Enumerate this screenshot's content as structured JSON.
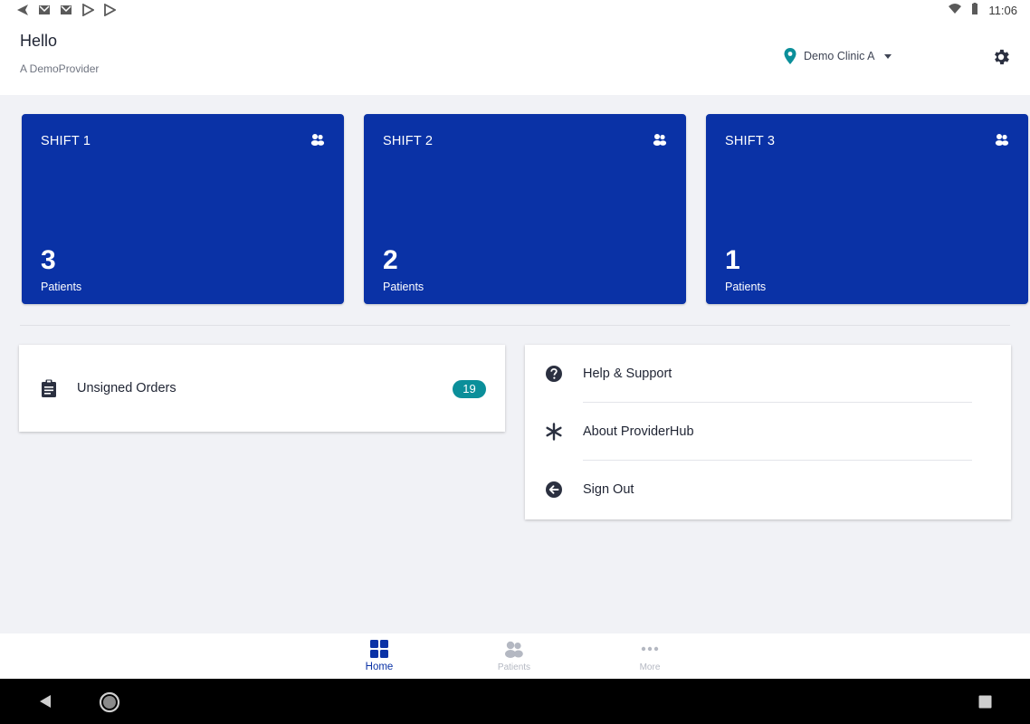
{
  "status_bar": {
    "time": "11:06",
    "icons": [
      "back-arrow-icon",
      "gmail-icon",
      "gmail-icon",
      "play-store-icon",
      "play-store-icon",
      "wifi-icon",
      "battery-icon"
    ]
  },
  "header": {
    "greeting": "Hello",
    "provider_name": "A DemoProvider",
    "clinic_name": "Demo Clinic A"
  },
  "shifts": [
    {
      "title": "SHIFT 1",
      "count": "3",
      "label": "Patients"
    },
    {
      "title": "SHIFT 2",
      "count": "2",
      "label": "Patients"
    },
    {
      "title": "SHIFT 3",
      "count": "1",
      "label": "Patients"
    }
  ],
  "orders": {
    "label": "Unsigned Orders",
    "count": "19"
  },
  "menu": [
    {
      "label": "Help & Support",
      "icon": "help-icon"
    },
    {
      "label": "About ProviderHub",
      "icon": "asterisk-icon"
    },
    {
      "label": "Sign Out",
      "icon": "sign-out-icon"
    }
  ],
  "bottom_nav": [
    {
      "label": "Home",
      "icon": "grid-icon",
      "active": true
    },
    {
      "label": "Patients",
      "icon": "patients-icon",
      "active": false
    },
    {
      "label": "More",
      "icon": "more-icon",
      "active": false
    }
  ],
  "colors": {
    "primary": "#0a32a6",
    "accent_teal": "#0b8f9a",
    "background": "#f1f2f6",
    "text": "#1f2433"
  }
}
